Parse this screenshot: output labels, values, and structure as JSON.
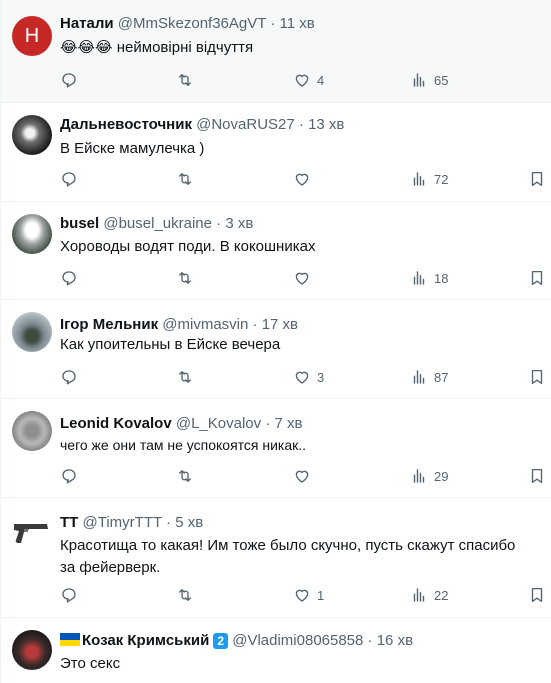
{
  "tweets": [
    {
      "name": "Натали",
      "handle": "@MmSkezonf36AgVT",
      "sep": "·",
      "time": "11 хв",
      "emoji": "😂😂😂",
      "text": "неймовірні відчуття",
      "likes": "4",
      "views": "65",
      "reply_count": "",
      "retweets": "",
      "avatar_letter": "H",
      "avatar_color": "#c62828"
    },
    {
      "name": "Дальневосточник",
      "handle": "@NovaRUS27",
      "sep": "·",
      "time": "13 хв",
      "text": "В Ейске мамулечка )",
      "likes": "",
      "views": "72"
    },
    {
      "name": "busel",
      "handle": "@busel_ukraine",
      "sep": "·",
      "time": "3 хв",
      "text": "Хороводы водят поди. В кокошниках",
      "likes": "",
      "views": "18"
    },
    {
      "name": "Ігор Мельник",
      "handle": "@mivmasvin",
      "sep": "·",
      "time": "17 хв",
      "text": "Как упоительны в Ейске вечера",
      "likes": "3",
      "views": "87"
    },
    {
      "name": "Leonid Kovalov",
      "handle": "@L_Kovalov",
      "sep": "·",
      "time": "7 хв",
      "text": "чего же они там не успокоятся никак..",
      "likes": "",
      "views": "29"
    },
    {
      "name": "TT",
      "handle": "@TimyrTTT",
      "sep": "·",
      "time": "5 хв",
      "text": "Красотища то какая! Им тоже было скучно, пусть скажут спасибо за фейерверк.",
      "likes": "1",
      "views": "22"
    },
    {
      "name": "Козак Кримський",
      "badge": "2",
      "handle": "@Vladimi08065858",
      "sep": "·",
      "time": "16 хв",
      "text": "Это секс"
    }
  ],
  "colors": {
    "accent": "#1d9bf0",
    "muted": "#536471",
    "text": "#0f1419",
    "flag_blue": "#0057b7",
    "flag_yellow": "#ffd700"
  }
}
